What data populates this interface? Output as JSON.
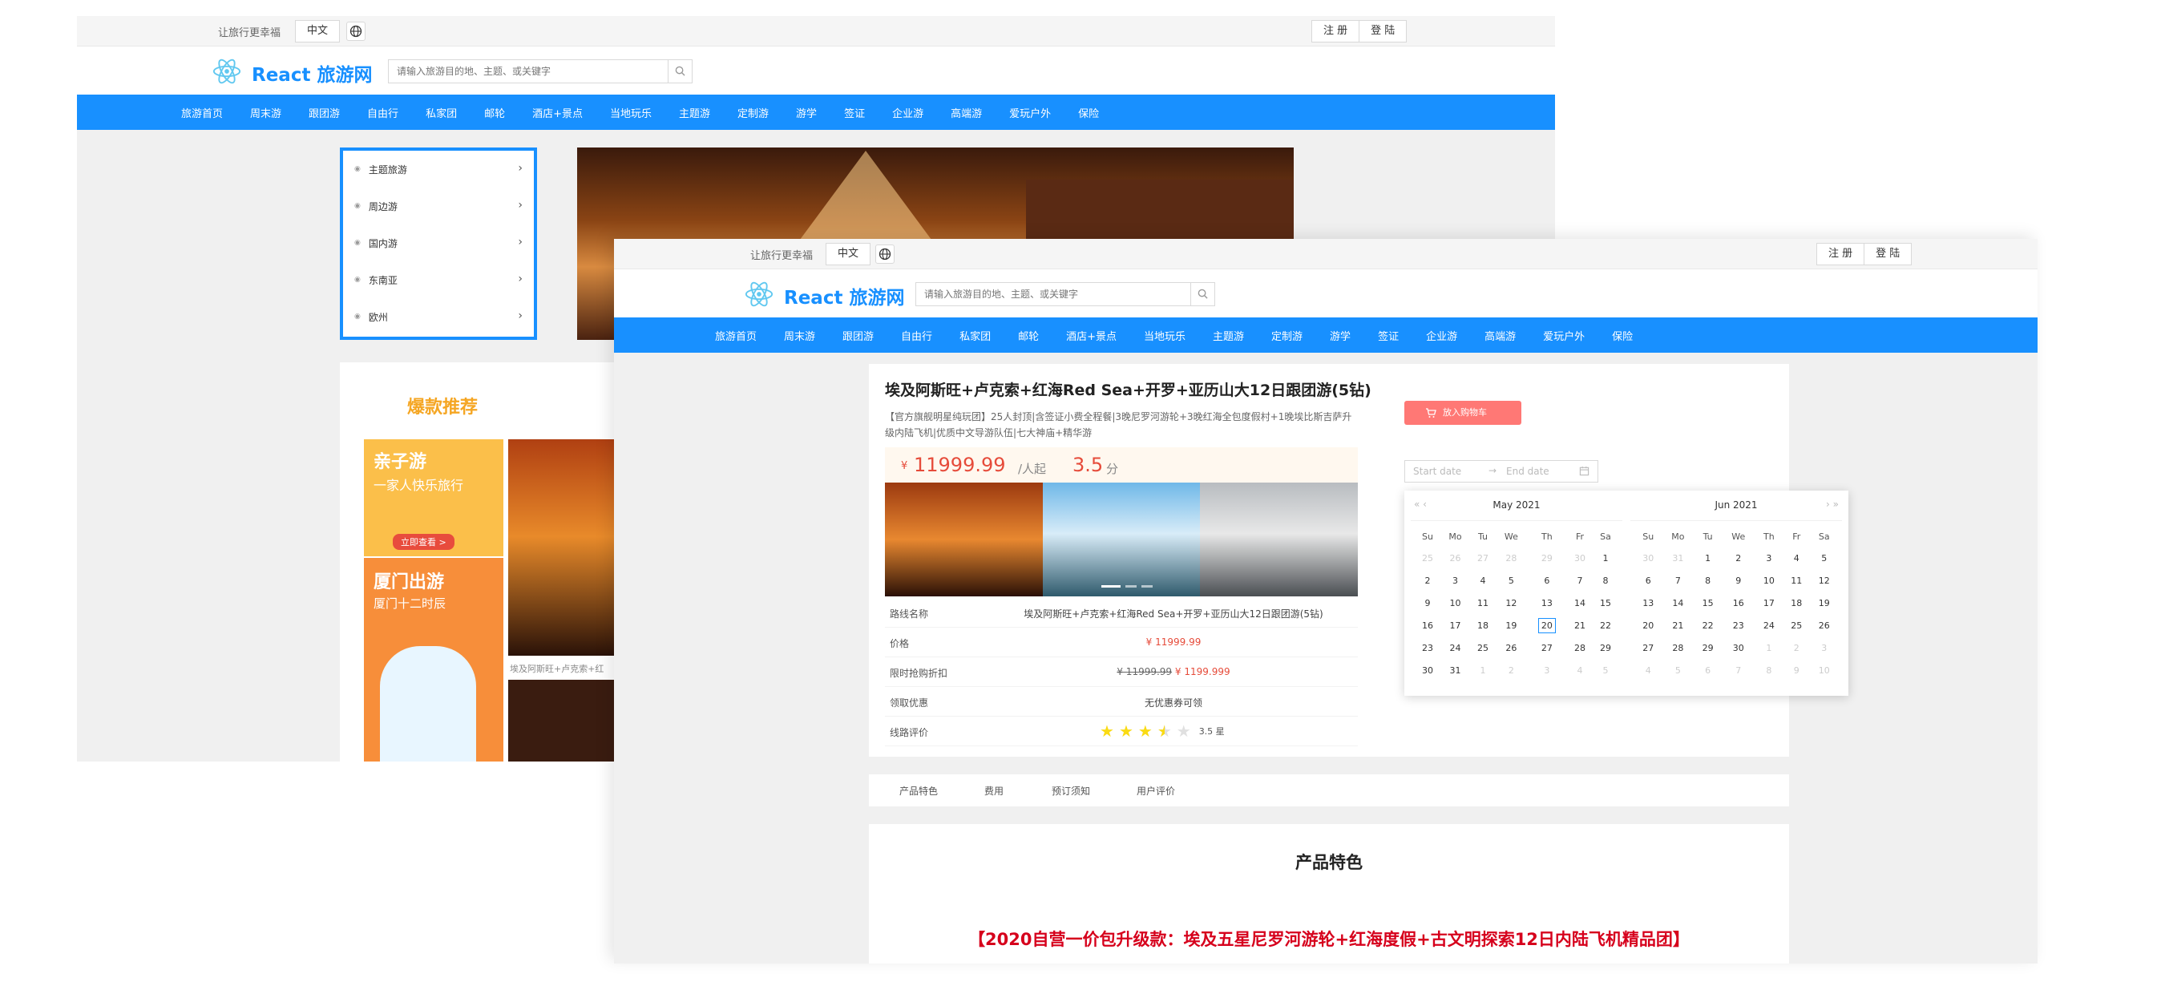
{
  "site": {
    "slogan": "让旅行更幸福",
    "lang": "中文",
    "register": "注 册",
    "login": "登 陆",
    "brand": "React 旅游网",
    "search_placeholder": "请输入旅游目的地、主题、或关键字",
    "nav": [
      "旅游首页",
      "周末游",
      "跟团游",
      "自由行",
      "私家团",
      "邮轮",
      "酒店+景点",
      "当地玩乐",
      "主题游",
      "定制游",
      "游学",
      "签证",
      "企业游",
      "高端游",
      "爱玩户外",
      "保险"
    ]
  },
  "home": {
    "side_menu": [
      "主题旅游",
      "周边游",
      "国内游",
      "东南亚",
      "欧州"
    ],
    "hot_title": "爆款推荐",
    "card1": {
      "title": "亲子游",
      "subtitle": "一家人快乐旅行",
      "button": "立即查看 >"
    },
    "card2": {
      "title": "厦门出游",
      "subtitle": "厦门十二时辰"
    },
    "photo_caption": "埃及阿斯旺+卢克索+红"
  },
  "detail": {
    "title": "埃及阿斯旺+卢克索+红海Red Sea+开罗+亚历山大12日跟团游(5钻)",
    "desc": "【官方旗舰明星纯玩团】25人封顶|含签证小费全程餐|3晚尼罗河游轮+3晚红海全包度假村+1晚埃比斯吉萨升级内陆飞机|优质中文导游队伍|七大神庙+精华游",
    "currency": "¥",
    "price": "11999.99",
    "price_unit": "/人起",
    "rating": "3.5",
    "rating_unit": "分",
    "rows": {
      "route_label": "路线名称",
      "route_value": "埃及阿斯旺+卢克索+红海Red Sea+开罗+亚历山大12日跟团游(5钻)",
      "price_label": "价格",
      "price_value": "¥ 11999.99",
      "discount_label": "限时抢购折扣",
      "discount_old": "¥ 11999.99",
      "discount_new": "¥ 1199.999",
      "coupon_label": "领取优惠",
      "coupon_value": "无优惠券可领",
      "review_label": "线路评价",
      "review_score": "3.5 星",
      "stars": 3.5
    },
    "cart_button": "放入购物车",
    "date_start": "Start date",
    "date_end": "End date"
  },
  "calendar": {
    "weekdays": [
      "Su",
      "Mo",
      "Tu",
      "We",
      "Th",
      "Fr",
      "Sa"
    ],
    "nav_prev": "« ‹",
    "nav_next": "› »",
    "left_title": "May  2021",
    "right_title": "Jun  2021",
    "left_days": [
      [
        "25",
        "26",
        "27",
        "28",
        "29",
        "30",
        "1"
      ],
      [
        "2",
        "3",
        "4",
        "5",
        "6",
        "7",
        "8"
      ],
      [
        "9",
        "10",
        "11",
        "12",
        "13",
        "14",
        "15"
      ],
      [
        "16",
        "17",
        "18",
        "19",
        "20",
        "21",
        "22"
      ],
      [
        "23",
        "24",
        "25",
        "26",
        "27",
        "28",
        "29"
      ],
      [
        "30",
        "31",
        "1",
        "2",
        "3",
        "4",
        "5"
      ]
    ],
    "right_days": [
      [
        "30",
        "31",
        "1",
        "2",
        "3",
        "4",
        "5"
      ],
      [
        "6",
        "7",
        "8",
        "9",
        "10",
        "11",
        "12"
      ],
      [
        "13",
        "14",
        "15",
        "16",
        "17",
        "18",
        "19"
      ],
      [
        "20",
        "21",
        "22",
        "23",
        "24",
        "25",
        "26"
      ],
      [
        "27",
        "28",
        "29",
        "30",
        "1",
        "2",
        "3"
      ],
      [
        "4",
        "5",
        "6",
        "7",
        "8",
        "9",
        "10"
      ]
    ],
    "today": "20"
  },
  "tabs": [
    "产品特色",
    "费用",
    "预订须知",
    "用户评价"
  ],
  "feature": {
    "heading": "产品特色",
    "subtitle": "【2020自营一价包升级款：埃及五星尼罗河游轮+红海度假+古文明探索12日内陆飞机精品团】"
  }
}
